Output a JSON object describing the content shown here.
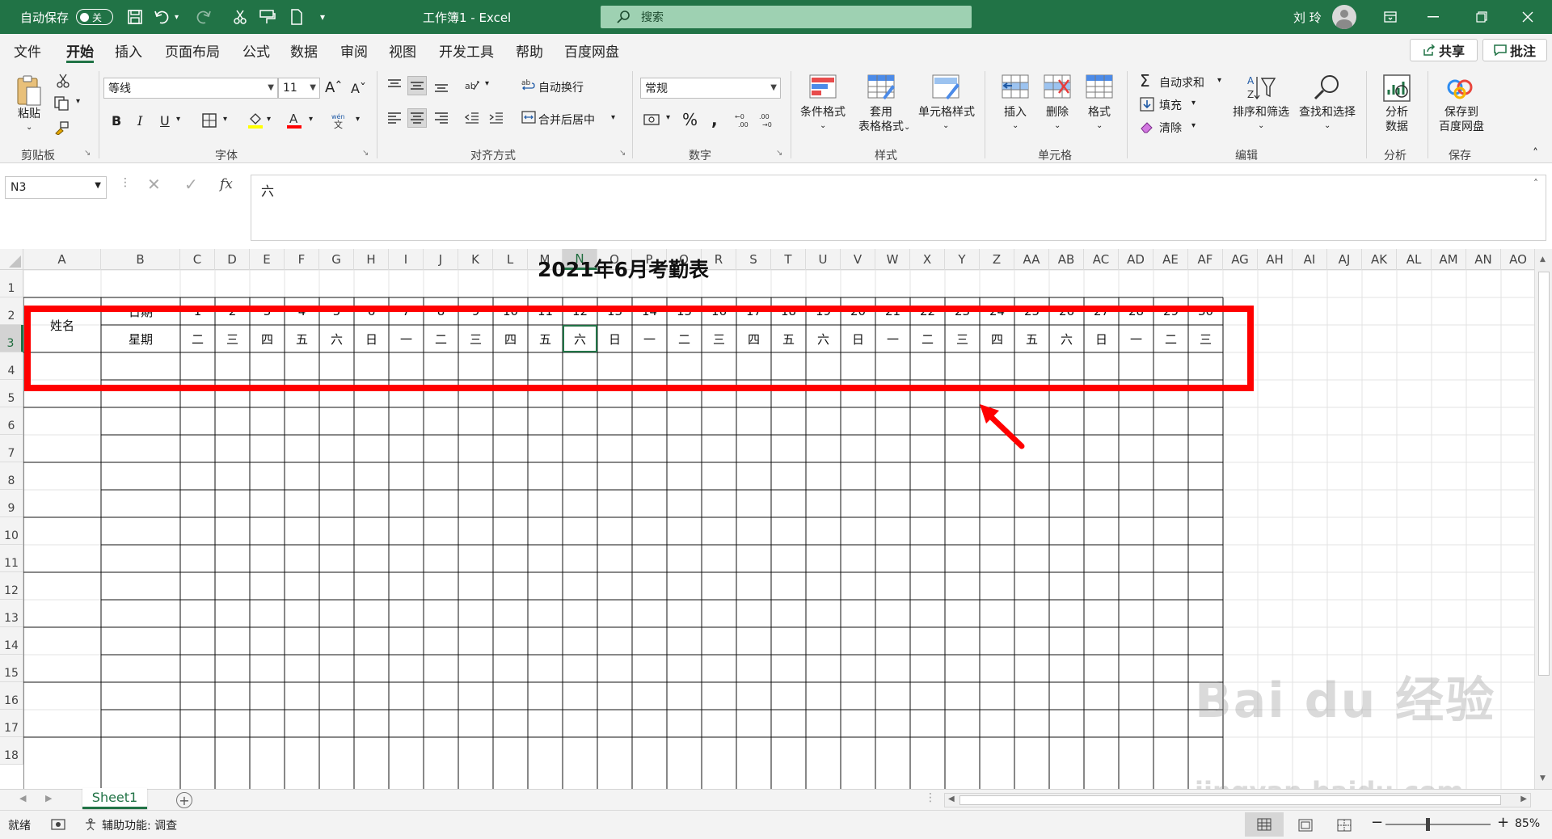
{
  "titlebar": {
    "autosave_label": "自动保存",
    "autosave_state": "关",
    "window_title": "工作簿1  -  Excel",
    "search_placeholder": "搜索",
    "user_name": "刘 玲"
  },
  "tabs": [
    "文件",
    "开始",
    "插入",
    "页面布局",
    "公式",
    "数据",
    "审阅",
    "视图",
    "开发工具",
    "帮助",
    "百度网盘"
  ],
  "active_tab": "开始",
  "share_label": "共享",
  "comment_label": "批注",
  "ribbon": {
    "clipboard": {
      "paste": "粘贴",
      "label": "剪贴板"
    },
    "font": {
      "name": "等线",
      "size": "11",
      "label": "字体",
      "bold": "B",
      "italic": "I",
      "underline": "U"
    },
    "alignment": {
      "wrap": "自动换行",
      "merge": "合并后居中",
      "label": "对齐方式"
    },
    "number": {
      "format": "常规",
      "label": "数字"
    },
    "styles": {
      "cond": "条件格式",
      "table1": "套用",
      "table2": "表格格式",
      "cell": "单元格样式",
      "label": "样式"
    },
    "cells": {
      "insert": "插入",
      "delete": "删除",
      "format": "格式",
      "label": "单元格"
    },
    "editing": {
      "autosum": "自动求和",
      "fill": "填充",
      "clear": "清除",
      "sort": "排序和筛选",
      "find": "查找和选择",
      "label": "编辑"
    },
    "analysis": {
      "btn1": "分析",
      "btn2": "数据",
      "label": "分析"
    },
    "save": {
      "btn1": "保存到",
      "btn2": "百度网盘",
      "label": "保存"
    }
  },
  "name_box": "N3",
  "formula_value": "六",
  "columns": [
    "A",
    "B",
    "C",
    "D",
    "E",
    "F",
    "G",
    "H",
    "I",
    "J",
    "K",
    "L",
    "M",
    "N",
    "O",
    "P",
    "Q",
    "R",
    "S",
    "T",
    "U",
    "V",
    "W",
    "X",
    "Y",
    "Z",
    "AA",
    "AB",
    "AC",
    "AD",
    "AE",
    "AF",
    "AG",
    "AH",
    "AI",
    "AJ",
    "AK",
    "AL",
    "AM",
    "AN",
    "AO"
  ],
  "selected_column": "N",
  "selected_row": 3,
  "rows": [
    1,
    2,
    3,
    4,
    5,
    6,
    7,
    8,
    9,
    10,
    11,
    12,
    13,
    14,
    15,
    16,
    17,
    18
  ],
  "sheet": {
    "title": "2021年6月考勤表",
    "name_label": "姓名",
    "date_label": "日期",
    "weekday_label": "星期",
    "dates": [
      "1",
      "2",
      "3",
      "4",
      "5",
      "6",
      "7",
      "8",
      "9",
      "10",
      "11",
      "12",
      "13",
      "14",
      "15",
      "16",
      "17",
      "18",
      "19",
      "20",
      "21",
      "22",
      "23",
      "24",
      "25",
      "26",
      "27",
      "28",
      "29",
      "30"
    ],
    "weekdays": [
      "二",
      "三",
      "四",
      "五",
      "六",
      "日",
      "一",
      "二",
      "三",
      "四",
      "五",
      "六",
      "日",
      "一",
      "二",
      "三",
      "四",
      "五",
      "六",
      "日",
      "一",
      "二",
      "三",
      "四",
      "五",
      "六",
      "日",
      "一",
      "二",
      "三"
    ]
  },
  "sheet_tab": "Sheet1",
  "status": {
    "ready": "就绪",
    "accessibility": "辅助功能: 调查",
    "zoom": "85%"
  },
  "watermark": {
    "logo": "Bai du 经验",
    "url": "jingyan.baidu.com"
  },
  "highlight_color": "#ff0000",
  "accent_color": "#217346"
}
